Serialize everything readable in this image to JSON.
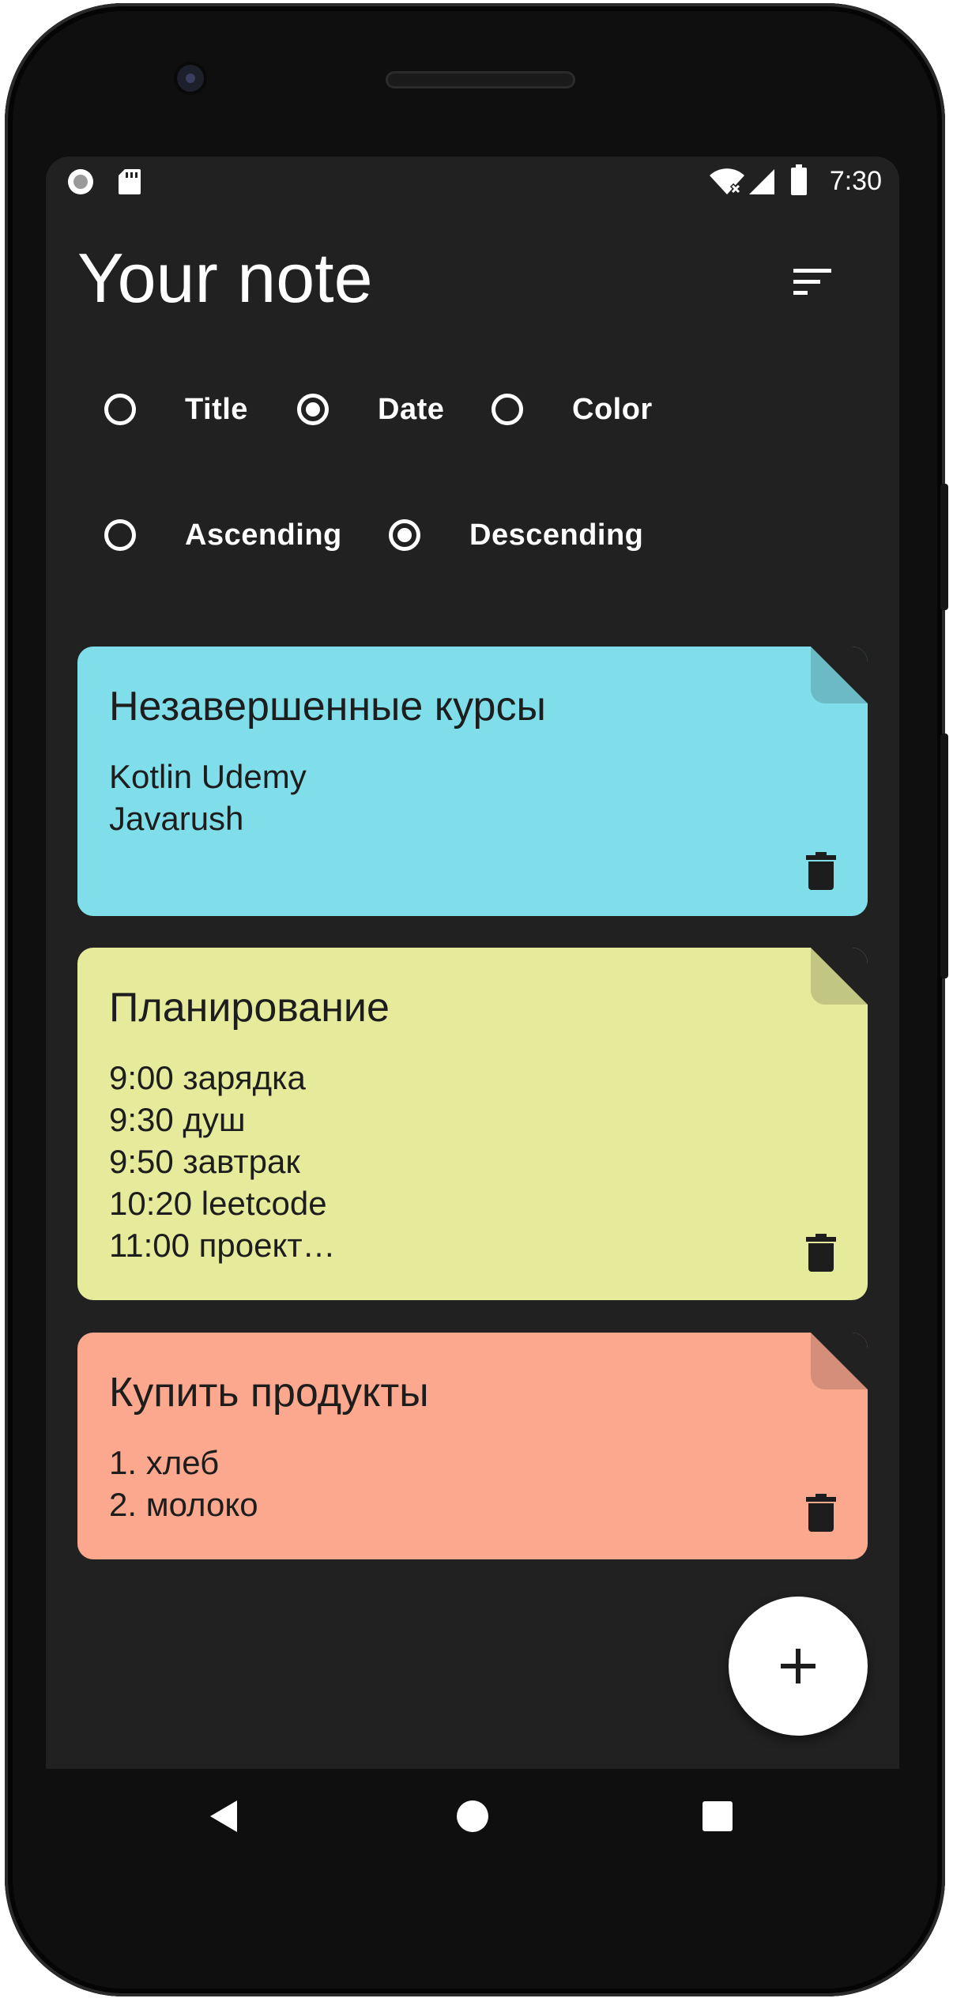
{
  "status_bar": {
    "time": "7:30",
    "left_icons": [
      "record-icon",
      "sd-card-icon"
    ],
    "right_icons": [
      "wifi-icon",
      "cellular-signal-icon",
      "battery-icon"
    ]
  },
  "header": {
    "title": "Your note",
    "sort_icon": "sort-icon"
  },
  "sort_by": {
    "options": [
      {
        "label": "Title",
        "checked": false
      },
      {
        "label": "Date",
        "checked": true
      },
      {
        "label": "Color",
        "checked": false
      }
    ]
  },
  "sort_order": {
    "options": [
      {
        "label": "Ascending",
        "checked": false
      },
      {
        "label": "Descending",
        "checked": true
      }
    ]
  },
  "notes": [
    {
      "title": "Незавершенные курсы",
      "lines": [
        "Kotlin Udemy",
        "Javarush"
      ],
      "color": "#80deea",
      "fold_color": "#6bbac5"
    },
    {
      "title": "Планирование",
      "lines": [
        "9:00 зарядка",
        "9:30 душ",
        "9:50 завтрак",
        "10:20 leetcode",
        "11:00 проект…"
      ],
      "color": "#e6ea9b",
      "fold_color": "#c2c683"
    },
    {
      "title": "Купить продукты",
      "lines": [
        "1. хлеб",
        "2. молоко"
      ],
      "color": "#fba88f",
      "fold_color": "#d48e79"
    }
  ],
  "fab": {
    "icon": "plus-icon"
  },
  "nav_bar": {
    "icons": [
      "back-icon",
      "home-icon",
      "recents-icon"
    ]
  }
}
